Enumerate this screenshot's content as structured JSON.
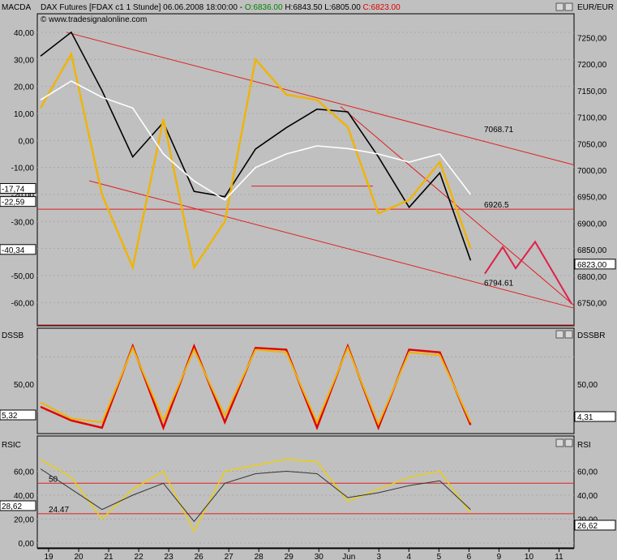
{
  "header": {
    "pane_label": "MACDA",
    "instrument": "DAX Futures [FDAX c1  1 Stunde] 06.06.2008 18:00:00 - ",
    "open": "O:6836.00",
    "high": " H:6843.50",
    "low": " L:6805.00",
    "close": " C:6823.00",
    "watermark": "© www.tradesignalonline.com",
    "right_label": "EUR/EUR",
    "colors": {
      "open": "#008000",
      "close": "#e00000",
      "text": "#000000"
    }
  },
  "panes": {
    "main": {
      "left_label": "MACDA",
      "right_label": "EUR/EUR",
      "left_ticks": [
        "40,00",
        "30,00",
        "20,00",
        "10,00",
        "0,00",
        "-10,00",
        "-20,00",
        "-30,00",
        "-40,00",
        "-50,00",
        "-60,00"
      ],
      "left_values": [
        "-17,74",
        "-22,59",
        "-40,34"
      ],
      "right_ticks": [
        "7250,00",
        "7200,00",
        "7150,00",
        "7100,00",
        "7050,00",
        "7000,00",
        "6950,00",
        "6900,00",
        "6850,00",
        "6800,00",
        "6750,00"
      ],
      "right_value": "6823,00",
      "annotations": [
        "7068.71",
        "6926.5",
        "6794.61"
      ]
    },
    "dss": {
      "left_label": "DSSB",
      "right_label": "DSSBR",
      "left_ticks": [
        "50,00"
      ],
      "right_ticks": [
        "50,00"
      ],
      "left_value": "5,32",
      "right_value": "4,31"
    },
    "rsi": {
      "left_label": "RSIC",
      "right_label": "RSI",
      "left_ticks": [
        "60,00",
        "40,00",
        "20,00",
        "0,00"
      ],
      "right_ticks": [
        "60,00",
        "40,00",
        "20,00"
      ],
      "left_value": "28,62",
      "right_value": "26,62",
      "level_labels": [
        "50",
        "24.47"
      ]
    }
  },
  "x_axis": {
    "labels": [
      "19",
      "20",
      "21",
      "22",
      "23",
      "26",
      "27",
      "28",
      "29",
      "30",
      "Jun",
      "3",
      "4",
      "5",
      "6",
      "9",
      "10",
      "11"
    ]
  },
  "chart_data": [
    {
      "type": "line",
      "title": "",
      "x": [
        "19",
        "20",
        "21",
        "22",
        "23",
        "26",
        "27",
        "28",
        "29",
        "30",
        "Jun",
        "3",
        "4",
        "5",
        "6"
      ],
      "series": [
        {
          "values": [
            7215,
            7260,
            7150,
            7025,
            7090,
            6960,
            6950,
            7040,
            7080,
            7115,
            7110,
            7025,
            6930,
            6995,
            6830
          ]
        },
        {
          "values": [
            12,
            32,
            -20,
            -47,
            8,
            -47,
            -30,
            30,
            17,
            15,
            5,
            -27,
            -22,
            -8,
            -40
          ]
        },
        {
          "values": [
            15,
            22,
            16,
            12,
            -5,
            -15,
            -22,
            -10,
            -5,
            -2,
            -3,
            -5,
            -8,
            -5,
            -20
          ]
        }
      ],
      "ylim_right": [
        6725,
        7275
      ],
      "ylim_left": [
        -65,
        43
      ],
      "annotations": [
        {
          "text": "7068.71",
          "value": 7068.71
        },
        {
          "text": "6926.5",
          "value": 6926.5
        },
        {
          "text": "6794.61",
          "value": 6794.61
        }
      ]
    },
    {
      "type": "line",
      "title": "",
      "series": [
        {
          "values": [
            25,
            10,
            2,
            92,
            2,
            92,
            8,
            90,
            88,
            2,
            92,
            2,
            88,
            85,
            5
          ]
        },
        {
          "values": [
            30,
            12,
            8,
            90,
            10,
            88,
            15,
            88,
            85,
            8,
            90,
            6,
            85,
            82,
            8
          ]
        }
      ],
      "ylim": [
        0,
        100
      ]
    },
    {
      "type": "line",
      "title": "",
      "series": [
        {
          "values": [
            70,
            55,
            20,
            45,
            60,
            10,
            60,
            65,
            70,
            68,
            35,
            45,
            55,
            60,
            25
          ]
        },
        {
          "values": [
            62,
            45,
            28,
            40,
            50,
            18,
            50,
            58,
            60,
            58,
            38,
            42,
            48,
            52,
            28
          ]
        }
      ],
      "levels": [
        50,
        24.47
      ],
      "ylim": [
        0,
        80
      ]
    }
  ]
}
